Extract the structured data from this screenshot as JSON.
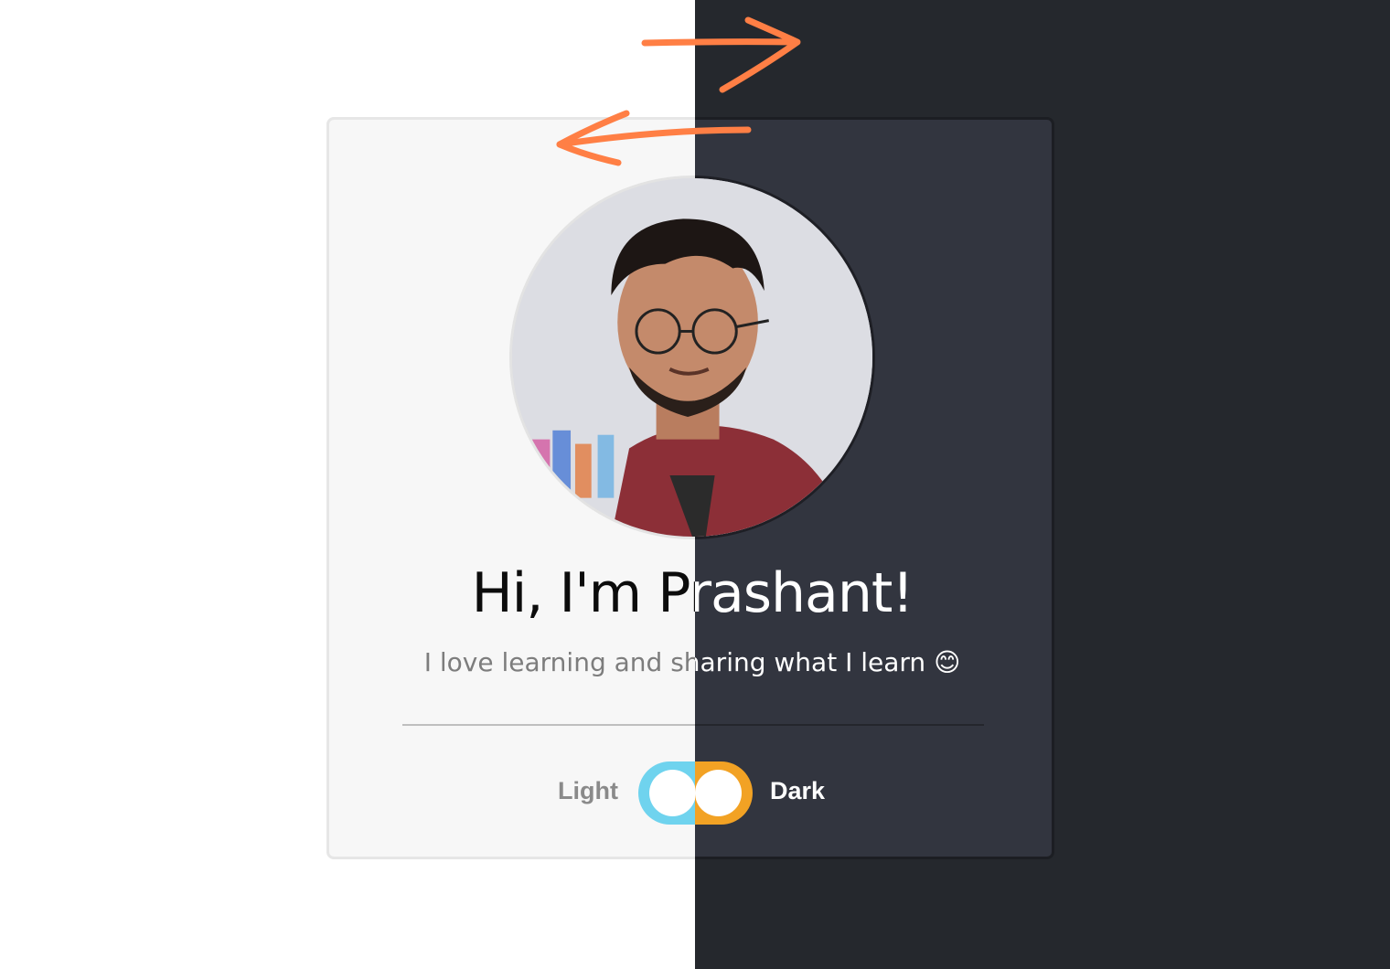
{
  "profile": {
    "greeting": "Hi, I'm Prashant!",
    "tagline": "I love learning and sharing what I learn 😊",
    "photo_alt": "Portrait of Prashant"
  },
  "theme_toggle": {
    "light_label": "Light",
    "dark_label": "Dark",
    "light_track_color": "#6fd3ee",
    "dark_track_color": "#f2a224"
  },
  "colors": {
    "light_background": "#ffffff",
    "dark_background": "#25282d",
    "light_card": "#f7f7f7",
    "dark_card": "#32353f",
    "arrow": "#ff7f45"
  }
}
